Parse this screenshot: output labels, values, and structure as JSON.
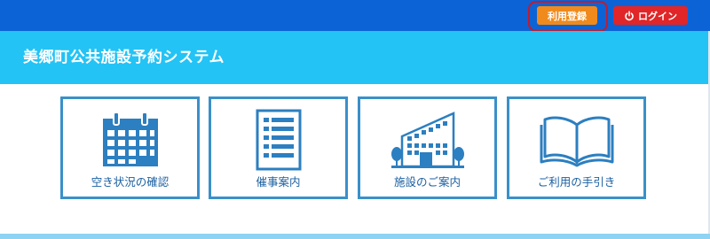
{
  "header": {
    "register_label": "利用登録",
    "login_label": "ログイン"
  },
  "site": {
    "title": "美郷町公共施設予約システム"
  },
  "menu": {
    "tiles": [
      {
        "label": "空き状況の確認",
        "icon": "calendar-icon"
      },
      {
        "label": "催事案内",
        "icon": "document-list-icon"
      },
      {
        "label": "施設のご案内",
        "icon": "building-icon"
      },
      {
        "label": "ご利用の手引き",
        "icon": "open-book-icon"
      }
    ]
  },
  "colors": {
    "topbar": "#0c63d6",
    "titlebar": "#23c3f5",
    "register_button": "#f08a1c",
    "login_button": "#e02628",
    "highlight_outline": "#c41a2c",
    "tile_border": "#3a90c9",
    "tile_text": "#1a5fa0",
    "icon_blue": "#2c7fc0"
  }
}
